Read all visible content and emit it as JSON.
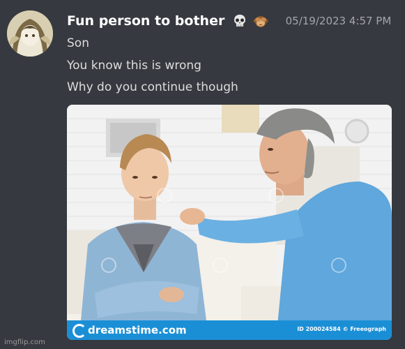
{
  "message": {
    "username": "Fun person to bother",
    "badge_icons": [
      "skull-emoji",
      "see-no-evil-monkey-emoji"
    ],
    "timestamp": "05/19/2023 4:57 PM",
    "lines": [
      "Son",
      "You know this is wrong",
      "Why do you continue though"
    ]
  },
  "attachment": {
    "brand": "dreamstime.com",
    "stock_id": "ID 200024584 © Freeograph"
  },
  "footer": {
    "watermark": "imgflip.com"
  },
  "colors": {
    "background": "#36393f",
    "username": "#ffffff",
    "timestamp": "#a3a6aa",
    "message_text": "#dcddde",
    "brand_bar": "#1b8fd6"
  }
}
